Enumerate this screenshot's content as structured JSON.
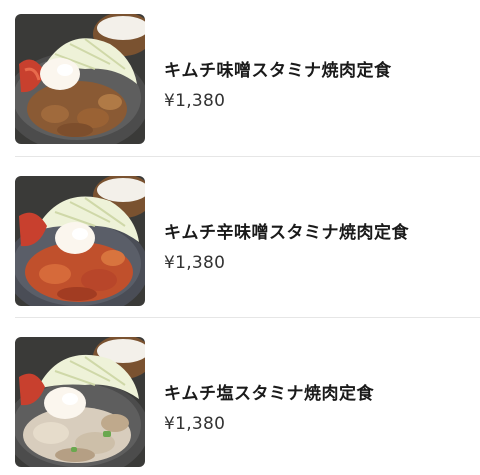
{
  "items": [
    {
      "name": "キムチ味噌スタミナ焼肉定食",
      "price": "¥1,380",
      "image": "kimchi-miso-stamina-yakiniku-photo"
    },
    {
      "name": "キムチ辛味噌スタミナ焼肉定食",
      "price": "¥1,380",
      "image": "kimchi-spicy-miso-stamina-yakiniku-photo"
    },
    {
      "name": "キムチ塩スタミナ焼肉定食",
      "price": "¥1,380",
      "image": "kimchi-salt-stamina-yakiniku-photo"
    }
  ],
  "colors": {
    "divider": "#e6e6e6",
    "text": "#1a1a1a",
    "price": "#333333"
  }
}
